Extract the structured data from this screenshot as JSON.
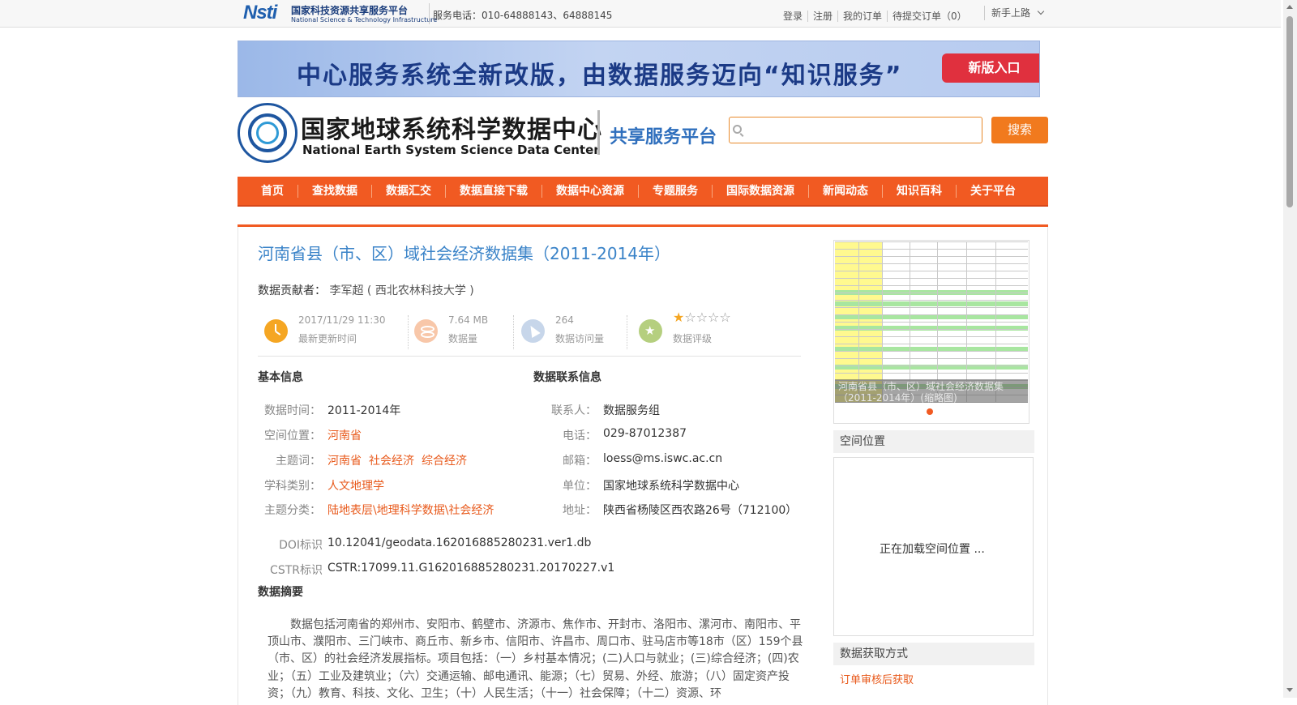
{
  "topbar": {
    "logo_cn": "国家科技资源共享服务平台",
    "logo_en": "National Science & Technology Infrastructure",
    "logo_mark": "Nsti",
    "phone": "服务电话：010-64888143、64888145",
    "links": [
      "登录",
      "注册",
      "我的订单",
      "待提交订单（0）"
    ],
    "newbie": "新手上路"
  },
  "banner": {
    "text": "中心服务系统全新改版，由数据服务迈向“知识服务”",
    "button": "新版入口"
  },
  "header": {
    "center_cn": "国家地球系统科学数据中心",
    "center_en": "National Earth System Science Data Center",
    "platform": "共享服务平台",
    "search_placeholder": "",
    "search_button": "搜索"
  },
  "nav": [
    "首页",
    "查找数据",
    "数据汇交",
    "数据直接下载",
    "数据中心资源",
    "专题服务",
    "国际数据资源",
    "新闻动态",
    "知识百科",
    "关于平台"
  ],
  "dataset": {
    "title": "河南省县（市、区）域社会经济数据集（2011-2014年）",
    "contributor_label": "数据贡献者：",
    "contributor": "李军超 ( 西北农林科技大学 )",
    "stats": [
      {
        "value": "2017/11/29 11:30",
        "label": "最新更新时间",
        "icon": "clock-icon"
      },
      {
        "value": "7.64 MB",
        "label": "数据量",
        "icon": "database-icon"
      },
      {
        "value": "264",
        "label": "数据访问量",
        "icon": "visit-icon"
      },
      {
        "value": "",
        "label": "数据评级",
        "icon": "star-icon"
      }
    ],
    "rating": 1,
    "rating_max": 5
  },
  "basic_info": {
    "heading": "基本信息",
    "time_label": "数据时间：",
    "time": "2011-2014年",
    "location_label": "空间位置：",
    "location": "河南省",
    "keywords_label": "主题词：",
    "keywords": [
      "河南省",
      "社会经济",
      "综合经济"
    ],
    "discipline_label": "学科类别：",
    "discipline": "人文地理学",
    "category_label": "主题分类：",
    "category": "陆地表层\\地理科学数据\\社会经济",
    "doi_label": "DOI标识",
    "doi": "10.12041/geodata.162016885280231.ver1.db",
    "cstr_label": "CSTR标识",
    "cstr": "CSTR:17099.11.G162016885280231.20170227.v1"
  },
  "contact_info": {
    "heading": "数据联系信息",
    "contact_label": "联系人：",
    "contact": "数据服务组",
    "phone_label": "电话：",
    "phone": "029-87012387",
    "email_label": "邮箱：",
    "email": "loess@ms.iswc.ac.cn",
    "org_label": "单位：",
    "org": "国家地球系统科学数据中心",
    "address_label": "地址：",
    "address": "陕西省杨陵区西农路26号（712100）"
  },
  "abstract": {
    "heading": "数据摘要",
    "text": "数据包括河南省的郑州市、安阳市、鹤壁市、济源市、焦作市、开封市、洛阳市、漯河市、南阳市、平顶山市、濮阳市、三门峡市、商丘市、新乡市、信阳市、许昌市、周口市、驻马店市等18市（区）159个县（市、区）的社会经济发展指标。项目包括：（一）乡村基本情况；(二)人口与就业；(三)综合经济；(四)农业；（五）工业及建筑业；（六）交通运输、邮电通讯、能源；（七）贸易、外经、旅游；（八）固定资产投资；（九）教育、科技、文化、卫生；（十）人民生活；（十一）社会保障；（十二）资源、环"
  },
  "sidebar": {
    "thumb_caption": "河南省县（市、区）域社会经济数据集（2011-2014年）(缩略图)",
    "spatial_heading": "空间位置",
    "map_loading": "正在加载空间位置 ...",
    "access_heading": "数据获取方式",
    "access_method": "订单审核后获取"
  },
  "colors": {
    "accent": "#f15a22",
    "title_blue": "#3a83c8",
    "link_orange": "#e85a1c"
  }
}
